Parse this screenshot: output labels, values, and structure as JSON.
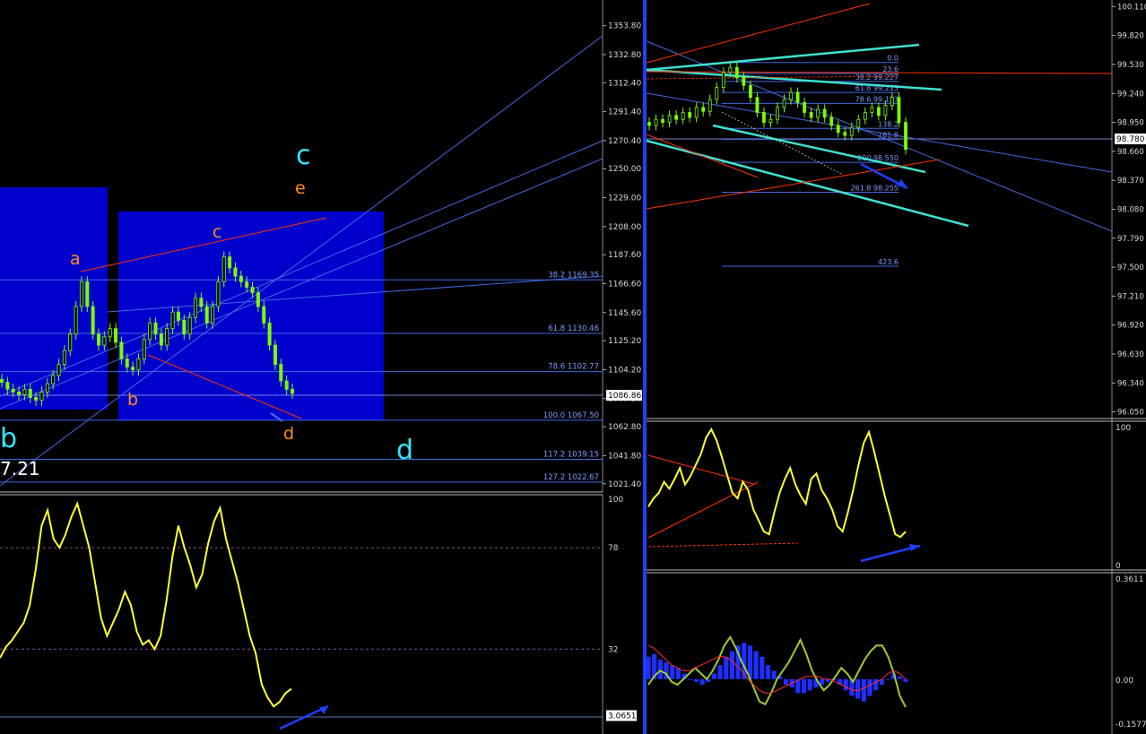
{
  "colors": {
    "background": "#000000",
    "candle": "#7CFC00",
    "oscillator": "#ffff33",
    "fib_line": "#4169e1",
    "trend_red": "#ff3300",
    "cyan_channel": "#40e0d0",
    "zone_blue": "#0000cd",
    "arrow_blue": "#1f3fff",
    "wave_orange": "#ff8c1a",
    "wave_cyan": "#33e6ff",
    "macd_hist": "#1f2fff",
    "macd_line": "#9acd32",
    "signal_line": "#ff2a2a",
    "price_tag_bg": "#ffffff"
  },
  "chart_data": [
    {
      "type": "line",
      "panel": "left-price",
      "yaxis_ticks": [
        "1353.80",
        "1332.80",
        "1312.40",
        "1291.40",
        "1270.40",
        "1250.00",
        "1229.00",
        "1208.00",
        "1187.60",
        "1166.60",
        "1145.60",
        "1125.20",
        "1104.20",
        "1083.20",
        "1062.80",
        "1041.80",
        "1021.40"
      ],
      "ylim": [
        1018,
        1362
      ],
      "current_price": "1086.86",
      "fib_levels": [
        {
          "ratio": "38.2",
          "price": "1169.35",
          "value": 1169.35
        },
        {
          "ratio": "61.8",
          "price": "1130.46",
          "value": 1130.46
        },
        {
          "ratio": "78.6",
          "price": "1102.77",
          "value": 1102.77
        },
        {
          "ratio": "100.0",
          "price": "1067.50",
          "value": 1067.5
        },
        {
          "ratio": "117.2",
          "price": "1039.15",
          "value": 1039.15
        },
        {
          "ratio": "127.2",
          "price": "1022.67",
          "value": 1022.67
        }
      ],
      "wave_labels": {
        "a": "a",
        "b": "b",
        "c": "c",
        "d": "d",
        "e": "e",
        "big_b": "b",
        "big_c": "c",
        "big_d": "d"
      },
      "partial_value": "7.21",
      "close_series": [
        1095,
        1090,
        1088,
        1086,
        1090,
        1084,
        1082,
        1088,
        1094,
        1100,
        1108,
        1118,
        1130,
        1150,
        1168,
        1150,
        1130,
        1122,
        1128,
        1134,
        1124,
        1112,
        1106,
        1104,
        1112,
        1126,
        1138,
        1130,
        1122,
        1134,
        1146,
        1140,
        1130,
        1142,
        1156,
        1150,
        1138,
        1150,
        1168,
        1186,
        1178,
        1172,
        1168,
        1164,
        1160,
        1150,
        1138,
        1122,
        1108,
        1096,
        1090,
        1087
      ]
    },
    {
      "type": "line",
      "panel": "left-oscillator",
      "yaxis_ticks": [
        "100",
        "78",
        "32",
        "3.0651"
      ],
      "ylim": [
        0,
        100
      ],
      "levels": [
        78,
        32
      ],
      "values": [
        28,
        33,
        36,
        40,
        44,
        52,
        68,
        88,
        95,
        82,
        78,
        84,
        92,
        98,
        88,
        78,
        62,
        46,
        38,
        44,
        50,
        58,
        52,
        40,
        34,
        36,
        32,
        38,
        54,
        74,
        88,
        78,
        70,
        60,
        66,
        80,
        90,
        96,
        82,
        72,
        62,
        50,
        38,
        30,
        16,
        10,
        6,
        8,
        12,
        14
      ]
    },
    {
      "type": "line",
      "panel": "right-price",
      "yaxis_ticks": [
        "100.110",
        "99.820",
        "99.530",
        "99.240",
        "98.950",
        "98.660",
        "98.370",
        "98.080",
        "97.790",
        "97.500",
        "97.210",
        "96.920",
        "96.630",
        "96.340",
        "96.050"
      ],
      "ylim": [
        96.02,
        100.14
      ],
      "current_price": "98.780",
      "fib_levels": [
        {
          "text": "0.0",
          "value": 99.55
        },
        {
          "text": "23.6",
          "value": 99.44
        },
        {
          "text": "38.2 99.227",
          "value": 99.36
        },
        {
          "text": "61.8 99.213",
          "value": 99.25
        },
        {
          "text": "78.6 99.123",
          "value": 99.14
        },
        {
          "text": "138.2",
          "value": 98.89
        },
        {
          "text": "161.8",
          "value": 98.78
        },
        {
          "text": "200 98.550",
          "value": 98.55
        },
        {
          "text": "261.8 98.255",
          "value": 98.25
        },
        {
          "text": "423.6",
          "value": 97.51
        }
      ],
      "close_series": [
        98.92,
        98.98,
        98.95,
        99.02,
        98.98,
        99.05,
        99.0,
        99.1,
        99.06,
        99.18,
        99.3,
        99.45,
        99.5,
        99.4,
        99.32,
        99.2,
        99.05,
        98.95,
        98.98,
        99.1,
        99.18,
        99.25,
        99.15,
        99.05,
        99.0,
        99.08,
        99.0,
        98.92,
        98.85,
        98.82,
        98.9,
        98.98,
        99.05,
        99.1,
        99.02,
        99.12,
        99.2,
        98.95,
        98.68
      ]
    },
    {
      "type": "line",
      "panel": "right-oscillator",
      "yaxis_ticks": [
        "100",
        "0"
      ],
      "ylim": [
        0,
        100
      ],
      "values": [
        42,
        48,
        52,
        60,
        55,
        62,
        70,
        58,
        64,
        72,
        80,
        92,
        98,
        90,
        78,
        65,
        52,
        48,
        60,
        54,
        40,
        32,
        24,
        22,
        38,
        52,
        62,
        70,
        58,
        50,
        44,
        62,
        66,
        54,
        48,
        40,
        28,
        24,
        38,
        54,
        72,
        88,
        96,
        82,
        66,
        50,
        36,
        22,
        20,
        24
      ]
    },
    {
      "type": "bar",
      "panel": "right-macd",
      "yaxis_ticks": [
        "0.3611",
        "0.00",
        "-0.1577"
      ],
      "ylim": [
        -0.1577,
        0.3611
      ],
      "histogram": [
        0.08,
        0.09,
        0.07,
        0.06,
        0.05,
        0.04,
        0.02,
        0.0,
        -0.01,
        -0.02,
        -0.01,
        0.02,
        0.05,
        0.08,
        0.1,
        0.12,
        0.13,
        0.12,
        0.1,
        0.08,
        0.05,
        0.03,
        0.01,
        -0.02,
        -0.03,
        -0.05,
        -0.05,
        -0.04,
        -0.03,
        -0.02,
        -0.01,
        0.0,
        -0.02,
        -0.04,
        -0.06,
        -0.07,
        -0.08,
        -0.06,
        -0.04,
        -0.02,
        0.0,
        0.02,
        0.01,
        -0.01
      ],
      "macd_line": [
        -0.02,
        0.01,
        0.03,
        0.02,
        -0.01,
        -0.02,
        0.0,
        0.02,
        0.04,
        0.02,
        0.0,
        0.03,
        0.07,
        0.12,
        0.15,
        0.11,
        0.06,
        0.02,
        -0.03,
        -0.08,
        -0.09,
        -0.05,
        0.0,
        0.03,
        0.06,
        0.1,
        0.14,
        0.09,
        0.03,
        -0.01,
        -0.04,
        -0.02,
        0.01,
        0.04,
        0.02,
        -0.01,
        0.03,
        0.07,
        0.1,
        0.12,
        0.12,
        0.08,
        0.02,
        -0.06,
        -0.1
      ],
      "signal_line": [
        0.12,
        0.11,
        0.09,
        0.07,
        0.05,
        0.04,
        0.03,
        0.03,
        0.04,
        0.05,
        0.06,
        0.07,
        0.08,
        0.08,
        0.07,
        0.05,
        0.03,
        0.0,
        -0.02,
        -0.04,
        -0.05,
        -0.05,
        -0.04,
        -0.03,
        -0.02,
        -0.01,
        0.0,
        0.01,
        0.01,
        0.01,
        0.0,
        0.0,
        -0.01,
        -0.02,
        -0.03,
        -0.04,
        -0.04,
        -0.03,
        -0.02,
        -0.01,
        0.0,
        0.02,
        0.03,
        0.02,
        0.0
      ]
    }
  ]
}
